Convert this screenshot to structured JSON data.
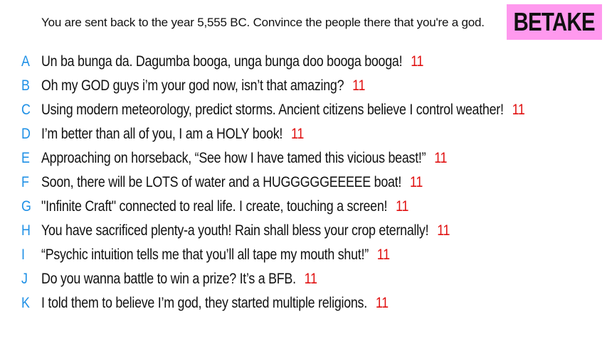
{
  "prompt": "You are sent back to the year 5,555 BC. Convince the people there that you're a god.",
  "badge": {
    "label": "BETAKE",
    "color": "#ff99ee"
  },
  "colors": {
    "letter": "#1e90e6",
    "score": "#e01010",
    "text": "#111111"
  },
  "answers": [
    {
      "letter": "A",
      "text": "Un ba bunga da. Dagumba booga, unga bunga doo booga booga!",
      "score": "11"
    },
    {
      "letter": "B",
      "text": "Oh my GOD guys i’m your god now, isn’t that amazing?",
      "score": "11"
    },
    {
      "letter": "C",
      "text": "Using modern meteorology, predict storms. Ancient citizens believe I control weather!",
      "score": "11"
    },
    {
      "letter": "D",
      "text": "I’m better than all of you, I am a HOLY book!",
      "score": "11"
    },
    {
      "letter": "E",
      "text": "Approaching on horseback, “See how I have tamed this vicious beast!”",
      "score": "11"
    },
    {
      "letter": "F",
      "text": "Soon, there will be LOTS of water and a HUGGGGGEEEEE boat!",
      "score": "11"
    },
    {
      "letter": "G",
      "text": "\"Infinite Craft\" connected to real life. I create, touching a screen!",
      "score": "11"
    },
    {
      "letter": "H",
      "text": "You have sacrificed plenty-a youth! Rain shall bless your crop eternally!",
      "score": "11"
    },
    {
      "letter": "I",
      "text": "“Psychic intuition tells me that you’ll all tape my mouth shut!”",
      "score": "11"
    },
    {
      "letter": "J",
      "text": "Do you wanna battle to win a prize? It’s a BFB.",
      "score": "11"
    },
    {
      "letter": "K",
      "text": "I told them to believe I’m god, they started multiple religions.",
      "score": "11"
    }
  ]
}
